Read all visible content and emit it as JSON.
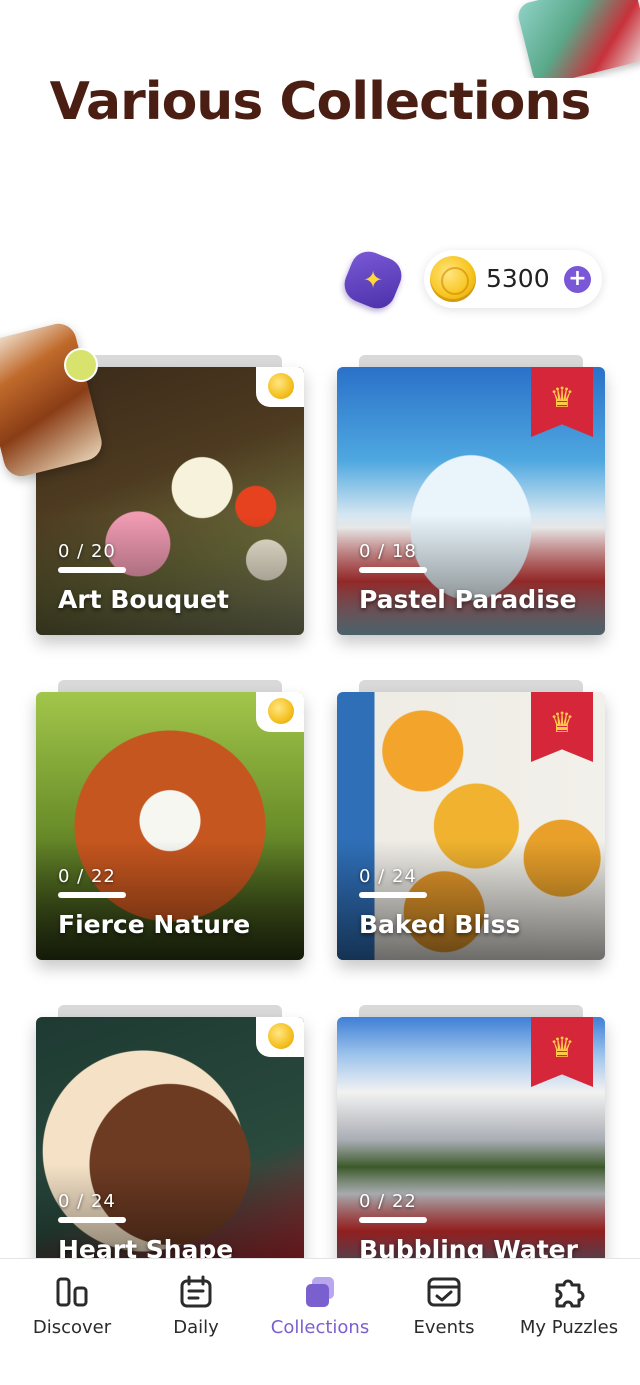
{
  "header": {
    "title": "Various Collections"
  },
  "currency": {
    "coins": "5300"
  },
  "collections": [
    {
      "name": "Art Bouquet",
      "progress": "0 / 20",
      "badge": "coin"
    },
    {
      "name": "Pastel Paradise",
      "progress": "0 / 18",
      "badge": "crown"
    },
    {
      "name": "Fierce Nature",
      "progress": "0 / 22",
      "badge": "coin"
    },
    {
      "name": "Baked Bliss",
      "progress": "0 / 24",
      "badge": "crown"
    },
    {
      "name": "Heart Shape",
      "progress": "0 / 24",
      "badge": "coin"
    },
    {
      "name": "Bubbling Water",
      "progress": "0 / 22",
      "badge": "crown"
    }
  ],
  "tabbar": {
    "active": "collections",
    "items": [
      {
        "label": "Discover",
        "icon": "discover-icon"
      },
      {
        "label": "Daily",
        "icon": "calendar-icon"
      },
      {
        "label": "Collections",
        "icon": "collections-icon"
      },
      {
        "label": "Events",
        "icon": "events-icon"
      },
      {
        "label": "My Puzzles",
        "icon": "puzzle-piece-icon"
      }
    ]
  },
  "colors": {
    "accent": "#7a5fcf",
    "title": "#4a1e12",
    "ribbon": "#d6273a",
    "coin": "#f8c620"
  }
}
